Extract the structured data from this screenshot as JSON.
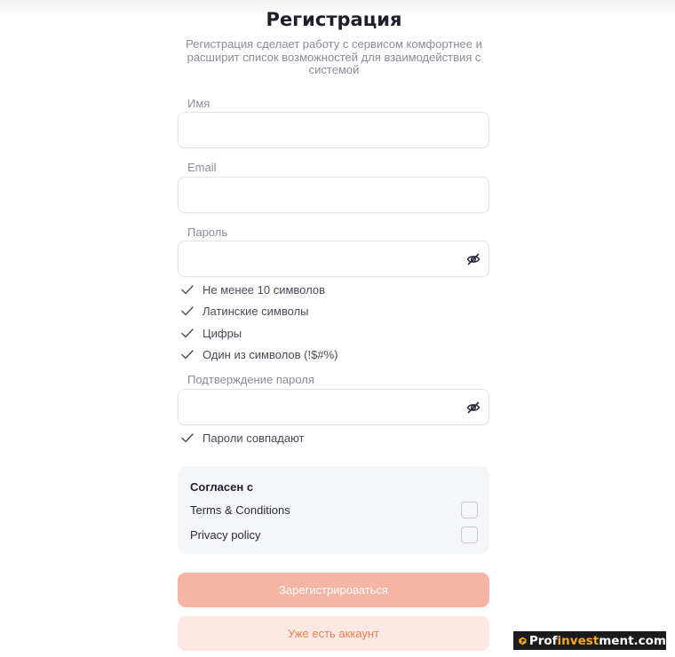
{
  "page": {
    "title": "Регистрация",
    "subtitle": "Регистрация сделает работу с сервисом комфортнее и расширит список возможностей для взаимодействия с системой"
  },
  "fields": {
    "name": {
      "label": "Имя",
      "value": "",
      "placeholder": ""
    },
    "email": {
      "label": "Email",
      "value": "",
      "placeholder": ""
    },
    "password": {
      "label": "Пароль",
      "value": "",
      "placeholder": ""
    },
    "confirm": {
      "label": "Подтверждение пароля",
      "value": "",
      "placeholder": ""
    }
  },
  "password_rules": [
    {
      "text": "Не менее 10 символов",
      "icon": "check-icon"
    },
    {
      "text": "Латинские символы",
      "icon": "check-icon"
    },
    {
      "text": "Цифры",
      "icon": "check-icon"
    },
    {
      "text": "Один из символов (!$#%)",
      "icon": "check-icon"
    }
  ],
  "confirm_rule": {
    "text": "Пароли совпадают",
    "icon": "check-icon"
  },
  "agreement": {
    "title": "Согласен с",
    "items": [
      {
        "label": "Terms & Conditions",
        "checked": false
      },
      {
        "label": "Privacy policy",
        "checked": false
      }
    ]
  },
  "buttons": {
    "register": "Зарегистрироваться",
    "have_account": "Уже есть аккаунт"
  },
  "watermark": {
    "prefix": "Prof",
    "accent": "invest",
    "suffix": "ment.com"
  },
  "colors": {
    "accent": "#ef7d52",
    "primary_button": "#f6b5a4",
    "secondary_button": "#fde9e3",
    "muted_text": "#8a8c99"
  }
}
